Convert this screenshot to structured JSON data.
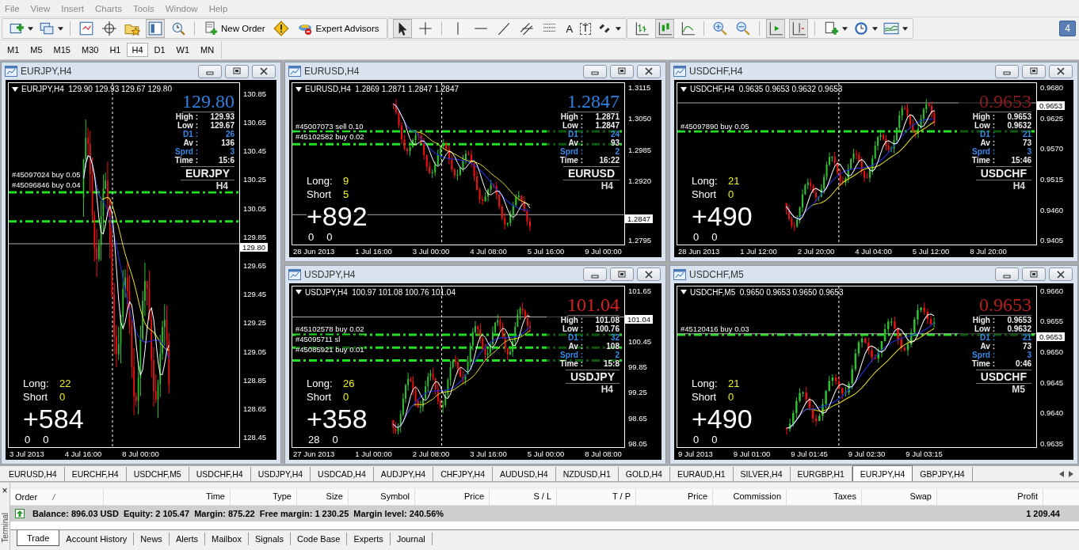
{
  "menu": [
    "File",
    "View",
    "Insert",
    "Charts",
    "Tools",
    "Window",
    "Help"
  ],
  "toolbar": {
    "new_order": "New Order",
    "expert_advisors": "Expert Advisors",
    "text_tool": "A",
    "label_tool": "T",
    "notifications": "4"
  },
  "timeframes": [
    {
      "label": "M1",
      "selected": false
    },
    {
      "label": "M5",
      "selected": false
    },
    {
      "label": "M15",
      "selected": false
    },
    {
      "label": "M30",
      "selected": false
    },
    {
      "label": "H1",
      "selected": false
    },
    {
      "label": "H4",
      "selected": true
    },
    {
      "label": "D1",
      "selected": false
    },
    {
      "label": "W1",
      "selected": false
    },
    {
      "label": "MN",
      "selected": false
    }
  ],
  "charts": [
    {
      "title": "EURJPY,H4",
      "header": "EURJPY,H4  129.90 129.93 129.67 129.80",
      "price": "129.80",
      "color": "#2f80e0",
      "stats": [
        {
          "label": "High :",
          "value": "129.93",
          "highlight": false
        },
        {
          "label": "Low :",
          "value": "129.67",
          "highlight": false
        },
        {
          "label": "D1 :",
          "value": "26",
          "highlight": true
        },
        {
          "label": "Av :",
          "value": "136",
          "highlight": false
        },
        {
          "label": "Sprd :",
          "value": "3",
          "highlight": true
        },
        {
          "label": "Time :",
          "value": "15:6",
          "highlight": false
        }
      ],
      "symbol": "EURJPY",
      "timeframe": "H4",
      "long_label": "Long:",
      "long": "22",
      "short_label": "Short",
      "short": "0",
      "profit": "+584",
      "counters": [
        "0",
        "0"
      ],
      "orders": [
        "#45097024 buy 0.05",
        "#45096846 buy 0.04"
      ],
      "price_tag": "129.80",
      "yticks": [
        "130.85",
        "130.65",
        "130.45",
        "130.25",
        "130.05",
        "129.85",
        "129.65",
        "129.45",
        "129.25",
        "129.05",
        "128.85",
        "128.65",
        "128.45"
      ],
      "xlabels": [
        "3 Jul 2013",
        "4 Jul 16:00",
        "8 Jul 00:00"
      ]
    },
    {
      "title": "EURUSD,H4",
      "header": "EURUSD,H4  1.2869 1.2871 1.2847 1.2847",
      "price": "1.2847",
      "color": "#2f80e0",
      "stats": [
        {
          "label": "High :",
          "value": "1.2871",
          "highlight": false
        },
        {
          "label": "Low :",
          "value": "1.2847",
          "highlight": false
        },
        {
          "label": "D1 :",
          "value": "24",
          "highlight": true
        },
        {
          "label": "Av :",
          "value": "93",
          "highlight": false
        },
        {
          "label": "Sprd :",
          "value": "2",
          "highlight": true
        },
        {
          "label": "Time :",
          "value": "16:22",
          "highlight": false
        }
      ],
      "symbol": "EURUSD",
      "timeframe": "H4",
      "long_label": "Long:",
      "long": "9",
      "short_label": "Short",
      "short": "5",
      "profit": "+892",
      "counters": [
        "0",
        "0"
      ],
      "orders": [
        "#45007073 sell 0.10",
        "#45102582 buy 0.02"
      ],
      "price_tag": "1.2847",
      "yticks": [
        "1.3115",
        "1.3050",
        "1.2985",
        "1.2920",
        "1.2795"
      ],
      "xlabels": [
        "28 Jun 2013",
        "1 Jul 16:00",
        "3 Jul 00:00",
        "4 Jul 08:00",
        "5 Jul 16:00",
        "9 Jul 00:00"
      ]
    },
    {
      "title": "USDCHF,H4",
      "header": "USDCHF,H4  0.9635 0.9653 0.9632 0.9653",
      "price": "0.9653",
      "color": "#8c1c1c",
      "stats": [
        {
          "label": "High :",
          "value": "0.9653",
          "highlight": false
        },
        {
          "label": "Low :",
          "value": "0.9632",
          "highlight": false
        },
        {
          "label": "D1 :",
          "value": "21",
          "highlight": true
        },
        {
          "label": "Av :",
          "value": "73",
          "highlight": false
        },
        {
          "label": "Sprd :",
          "value": "3",
          "highlight": true
        },
        {
          "label": "Time :",
          "value": "15:46",
          "highlight": false
        }
      ],
      "symbol": "USDCHF",
      "timeframe": "H4",
      "long_label": "Long:",
      "long": "21",
      "short_label": "Short",
      "short": "0",
      "profit": "+490",
      "counters": [
        "0",
        "0"
      ],
      "orders": [
        "#45097890 buy 0.05"
      ],
      "price_tag": "0.9653",
      "yticks": [
        "0.9680",
        "0.9625",
        "0.9570",
        "0.9515",
        "0.9460",
        "0.9405"
      ],
      "xlabels": [
        "28 Jun 2013",
        "1 Jul 12:00",
        "2 Jul 20:00",
        "4 Jul 04:00",
        "5 Jul 12:00",
        "8 Jul 20:00"
      ]
    },
    {
      "title": "USDJPY,H4",
      "header": "USDJPY,H4  100.97 101.08 100.76 101.04",
      "price": "101.04",
      "color": "#d42020",
      "stats": [
        {
          "label": "High :",
          "value": "101.08",
          "highlight": false
        },
        {
          "label": "Low :",
          "value": "100.76",
          "highlight": false
        },
        {
          "label": "D1 :",
          "value": "32",
          "highlight": true
        },
        {
          "label": "Av :",
          "value": "108",
          "highlight": false
        },
        {
          "label": "Sprd :",
          "value": "2",
          "highlight": true
        },
        {
          "label": "Time :",
          "value": "15:8",
          "highlight": false
        }
      ],
      "symbol": "USDJPY",
      "timeframe": "H4",
      "long_label": "Long:",
      "long": "26",
      "short_label": "Short",
      "short": "0",
      "profit": "+358",
      "counters": [
        "28",
        "0"
      ],
      "orders": [
        "#45102578 buy 0.02",
        "#45095711 sl",
        "#45085921 buy 0.01"
      ],
      "price_tag": "101.04",
      "yticks": [
        "101.65",
        "100.45",
        "99.85",
        "99.25",
        "98.65",
        "98.05"
      ],
      "xlabels": [
        "27 Jun 2013",
        "1 Jul 00:00",
        "2 Jul 08:00",
        "3 Jul 16:00",
        "5 Jul 00:00",
        "8 Jul 08:00"
      ]
    },
    {
      "title": "USDCHF,M5",
      "header": "USDCHF,M5  0.9650 0.9653 0.9650 0.9653",
      "price": "0.9653",
      "color": "#b81e1e",
      "stats": [
        {
          "label": "High :",
          "value": "0.9653",
          "highlight": false
        },
        {
          "label": "Low :",
          "value": "0.9632",
          "highlight": false
        },
        {
          "label": "D1 :",
          "value": "21",
          "highlight": true
        },
        {
          "label": "Av :",
          "value": "73",
          "highlight": false
        },
        {
          "label": "Sprd :",
          "value": "3",
          "highlight": true
        },
        {
          "label": "Time :",
          "value": "0:46",
          "highlight": false
        }
      ],
      "symbol": "USDCHF",
      "timeframe": "M5",
      "long_label": "Long:",
      "long": "21",
      "short_label": "Short",
      "short": "0",
      "profit": "+490",
      "counters": [
        "0",
        "0"
      ],
      "orders": [
        "#45120416 buy 0.03"
      ],
      "price_tag": "0.9653",
      "yticks": [
        "0.9660",
        "0.9655",
        "0.9650",
        "0.9645",
        "0.9640",
        "0.9635"
      ],
      "xlabels": [
        "9 Jul 2013",
        "9 Jul 01:00",
        "9 Jul 01:45",
        "9 Jul 02:30",
        "9 Jul 03:15"
      ]
    }
  ],
  "symbol_tabs": [
    {
      "label": "EURUSD,H4",
      "selected": false
    },
    {
      "label": "EURCHF,H4",
      "selected": false
    },
    {
      "label": "USDCHF,M5",
      "selected": false
    },
    {
      "label": "USDCHF,H4",
      "selected": false
    },
    {
      "label": "USDJPY,H4",
      "selected": false
    },
    {
      "label": "USDCAD,H4",
      "selected": false
    },
    {
      "label": "AUDJPY,H4",
      "selected": false
    },
    {
      "label": "CHFJPY,H4",
      "selected": false
    },
    {
      "label": "AUDUSD,H4",
      "selected": false
    },
    {
      "label": "NZDUSD,H1",
      "selected": false
    },
    {
      "label": "GOLD,H4",
      "selected": false
    },
    {
      "label": "EURAUD,H1",
      "selected": false
    },
    {
      "label": "SILVER,H4",
      "selected": false
    },
    {
      "label": "EURGBP,H1",
      "selected": false
    },
    {
      "label": "EURJPY,H4",
      "selected": true
    },
    {
      "label": "GBPJPY,H4",
      "selected": false
    }
  ],
  "terminal": {
    "title": "Terminal",
    "close": "×",
    "columns": [
      "Order",
      "Time",
      "Type",
      "Size",
      "Symbol",
      "Price",
      "S / L",
      "T / P",
      "Price",
      "Commission",
      "Taxes",
      "Swap",
      "Profit"
    ],
    "balance": "Balance: 896.03 USD  Equity: 2 105.47  Margin: 875.22  Free margin: 1 230.25  Margin level: 240.56%",
    "profit": "1 209.44",
    "tabs": [
      {
        "label": "Trade",
        "selected": true
      },
      {
        "label": "Account History",
        "selected": false
      },
      {
        "label": "News",
        "selected": false
      },
      {
        "label": "Alerts",
        "selected": false
      },
      {
        "label": "Mailbox",
        "selected": false
      },
      {
        "label": "Signals",
        "selected": false
      },
      {
        "label": "Code Base",
        "selected": false
      },
      {
        "label": "Experts",
        "selected": false
      },
      {
        "label": "Journal",
        "selected": false
      }
    ]
  }
}
